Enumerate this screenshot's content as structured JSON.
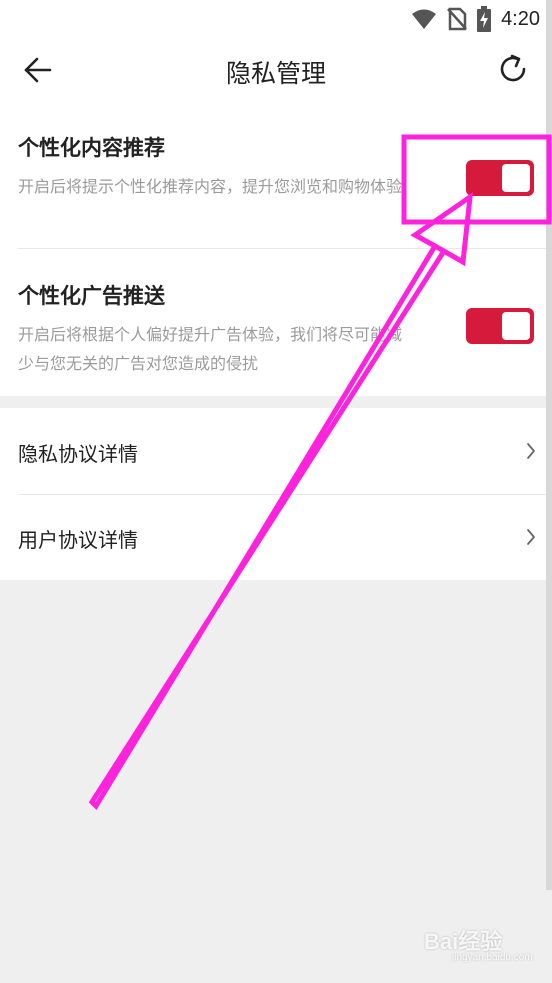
{
  "status_bar": {
    "time": "4:20",
    "icons": [
      "wifi-icon",
      "no-sim-icon",
      "battery-charging-icon"
    ]
  },
  "navbar": {
    "title": "隐私管理",
    "back_icon": "arrow-left-icon",
    "refresh_icon": "refresh-icon"
  },
  "settings": {
    "toggles": [
      {
        "title": "个性化内容推荐",
        "description": "开启后将提示个性化推荐内容，提升您浏览和购物体验",
        "enabled": true
      },
      {
        "title": "个性化广告推送",
        "description": "开启后将根据个人偏好提升广告体验，我们将尽可能减少与您无关的广告对您造成的侵扰",
        "enabled": true
      }
    ],
    "links": [
      {
        "label": "隐私协议详情",
        "icon": "chevron-right-icon"
      },
      {
        "label": "用户协议详情",
        "icon": "chevron-right-icon"
      }
    ]
  },
  "colors": {
    "accent": "#d61a3c",
    "annotation": "#ff22dd",
    "background": "#efefef"
  },
  "watermark": {
    "text": "Bai经验",
    "sub": "jingyan.baidu.com"
  }
}
